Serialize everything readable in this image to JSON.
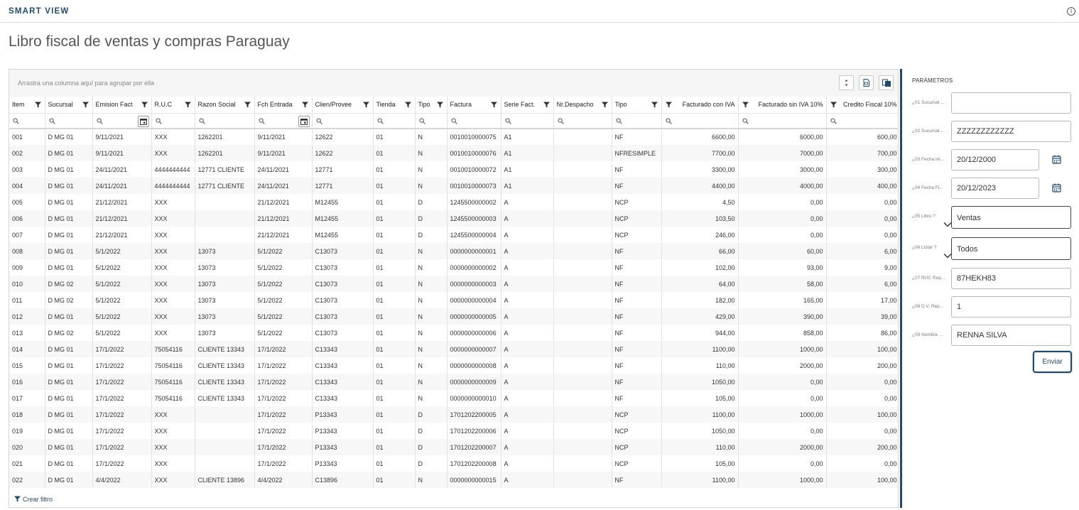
{
  "app_title": "SMART VIEW",
  "page_title": "Libro fiscal de ventas y compras Paraguay",
  "grid": {
    "group_hint": "Arrastra una columna aquí para agrupar por ella",
    "columns": [
      "Item",
      "Sucursal",
      "Emision Fact",
      "R.U.C",
      "Razon Social",
      "Fch Entrada",
      "Clien/Provee",
      "Tienda",
      "Tipo",
      "Factura",
      "Serie Fact.",
      "Nr.Despacho",
      "Tipo",
      "Facturado con IVA",
      "Facturado sin IVA 10%",
      "Credito Fiscal 10%"
    ],
    "rows": [
      [
        "001",
        "D MG 01",
        "9/11/2021",
        "XXX",
        "1262201",
        "9/11/2021",
        "12622",
        "01",
        "N",
        "0010010000075",
        "A1",
        "",
        "NF",
        "6600,00",
        "6000,00",
        "600,00"
      ],
      [
        "002",
        "D MG 01",
        "9/11/2021",
        "XXX",
        "1262201",
        "9/11/2021",
        "12622",
        "01",
        "N",
        "0010010000076",
        "A1",
        "",
        "NFRESIMPLE",
        "7700,00",
        "7000,00",
        "700,00"
      ],
      [
        "003",
        "D MG 01",
        "24/11/2021",
        "4444444444",
        "12771 CLIENTE",
        "24/11/2021",
        "12771",
        "01",
        "N",
        "0010010000072",
        "A1",
        "",
        "NF",
        "3300,00",
        "3000,00",
        "300,00"
      ],
      [
        "004",
        "D MG 01",
        "24/11/2021",
        "4444444444",
        "12771 CLIENTE",
        "24/11/2021",
        "12771",
        "01",
        "N",
        "0010010000073",
        "A1",
        "",
        "NF",
        "4400,00",
        "4000,00",
        "400,00"
      ],
      [
        "005",
        "D MG 01",
        "21/12/2021",
        "XXX",
        "",
        "21/12/2021",
        "M12455",
        "01",
        "D",
        "1245500000002",
        "A",
        "",
        "NCP",
        "4,50",
        "0,00",
        "0,00"
      ],
      [
        "006",
        "D MG 01",
        "21/12/2021",
        "XXX",
        "",
        "21/12/2021",
        "M12455",
        "01",
        "D",
        "1245500000003",
        "A",
        "",
        "NCP",
        "103,50",
        "0,00",
        "0,00"
      ],
      [
        "007",
        "D MG 01",
        "21/12/2021",
        "XXX",
        "",
        "21/12/2021",
        "M12455",
        "01",
        "D",
        "1245500000004",
        "A",
        "",
        "NCP",
        "246,00",
        "0,00",
        "0,00"
      ],
      [
        "008",
        "D MG 01",
        "5/1/2022",
        "XXX",
        "13073",
        "5/1/2022",
        "C13073",
        "01",
        "N",
        "0000000000001",
        "A",
        "",
        "NF",
        "66,00",
        "60,00",
        "6,00"
      ],
      [
        "009",
        "D MG 01",
        "5/1/2022",
        "XXX",
        "13073",
        "5/1/2022",
        "C13073",
        "01",
        "N",
        "0000000000002",
        "A",
        "",
        "NF",
        "102,00",
        "93,00",
        "9,00"
      ],
      [
        "010",
        "D MG 02",
        "5/1/2022",
        "XXX",
        "13073",
        "5/1/2022",
        "C13073",
        "01",
        "N",
        "0000000000003",
        "A",
        "",
        "NF",
        "64,00",
        "58,00",
        "6,00"
      ],
      [
        "011",
        "D MG 02",
        "5/1/2022",
        "XXX",
        "13073",
        "5/1/2022",
        "C13073",
        "01",
        "N",
        "0000000000004",
        "A",
        "",
        "NF",
        "182,00",
        "165,00",
        "17,00"
      ],
      [
        "012",
        "D MG 01",
        "5/1/2022",
        "XXX",
        "13073",
        "5/1/2022",
        "C13073",
        "01",
        "N",
        "0000000000005",
        "A",
        "",
        "NF",
        "429,00",
        "390,00",
        "39,00"
      ],
      [
        "013",
        "D MG 02",
        "5/1/2022",
        "XXX",
        "13073",
        "5/1/2022",
        "C13073",
        "01",
        "N",
        "0000000000006",
        "A",
        "",
        "NF",
        "944,00",
        "858,00",
        "86,00"
      ],
      [
        "014",
        "D MG 01",
        "17/1/2022",
        "75054116",
        "CLIENTE 13343",
        "17/1/2022",
        "C13343",
        "01",
        "N",
        "0000000000007",
        "A",
        "",
        "NF",
        "1100,00",
        "1000,00",
        "100,00"
      ],
      [
        "015",
        "D MG 01",
        "17/1/2022",
        "75054116",
        "CLIENTE 13343",
        "17/1/2022",
        "C13343",
        "01",
        "N",
        "0000000000008",
        "A",
        "",
        "NF",
        "110,00",
        "2000,00",
        "200,00"
      ],
      [
        "016",
        "D MG 01",
        "17/1/2022",
        "75054116",
        "CLIENTE 13343",
        "17/1/2022",
        "C13343",
        "01",
        "N",
        "0000000000009",
        "A",
        "",
        "NF",
        "1050,00",
        "0,00",
        "0,00"
      ],
      [
        "017",
        "D MG 01",
        "17/1/2022",
        "75054116",
        "CLIENTE 13343",
        "17/1/2022",
        "C13343",
        "01",
        "N",
        "0000000000010",
        "A",
        "",
        "NF",
        "105,00",
        "0,00",
        "0,00"
      ],
      [
        "018",
        "D MG 01",
        "17/1/2022",
        "XXX",
        "",
        "17/1/2022",
        "P13343",
        "01",
        "D",
        "1701202200005",
        "A",
        "",
        "NCP",
        "1100,00",
        "1000,00",
        "100,00"
      ],
      [
        "019",
        "D MG 01",
        "17/1/2022",
        "XXX",
        "",
        "17/1/2022",
        "P13343",
        "01",
        "D",
        "1701202200006",
        "A",
        "",
        "NCP",
        "1050,00",
        "0,00",
        "0,00"
      ],
      [
        "020",
        "D MG 01",
        "17/1/2022",
        "XXX",
        "",
        "17/1/2022",
        "P13343",
        "01",
        "D",
        "1701202200007",
        "A",
        "",
        "NCP",
        "110,00",
        "2000,00",
        "200,00"
      ],
      [
        "021",
        "D MG 01",
        "17/1/2022",
        "XXX",
        "",
        "17/1/2022",
        "P13343",
        "01",
        "D",
        "1701202200008",
        "A",
        "",
        "NCP",
        "105,00",
        "0,00",
        "0,00"
      ],
      [
        "022",
        "D MG 01",
        "4/4/2022",
        "XXX",
        "CLIENTE 13896",
        "4/4/2022",
        "C13896",
        "01",
        "N",
        "0000000000015",
        "A",
        "",
        "NF",
        "1100,00",
        "1000,00",
        "100,00"
      ]
    ],
    "create_filter": "Crear filtro"
  },
  "params": {
    "title": "PARÁMETROS",
    "fields": [
      {
        "label": "¿01 Sucursal ...",
        "value": "",
        "kind": "text"
      },
      {
        "label": "¿02 Sucursal ...",
        "value": "ZZZZZZZZZZZZ",
        "kind": "text"
      },
      {
        "label": "¿03 Fecha Ini...",
        "value": "20/12/2000",
        "kind": "date"
      },
      {
        "label": "¿04 Fecha Fi...",
        "value": "20/12/2023",
        "kind": "date"
      },
      {
        "label": "¿05 Libro ?",
        "value": "Ventas",
        "kind": "select"
      },
      {
        "label": "¿06 Listar ?",
        "value": "Todos",
        "kind": "select"
      },
      {
        "label": "¿07 RUC Rep...",
        "value": "87HEKH83",
        "kind": "text"
      },
      {
        "label": "¿08 D.V. Rep...",
        "value": "1",
        "kind": "text"
      },
      {
        "label": "¿09 Nombre ...",
        "value": "RENNA SILVA",
        "kind": "text"
      }
    ],
    "submit_label": "Enviar"
  },
  "colors": {
    "accent": "#1f4b6e"
  }
}
